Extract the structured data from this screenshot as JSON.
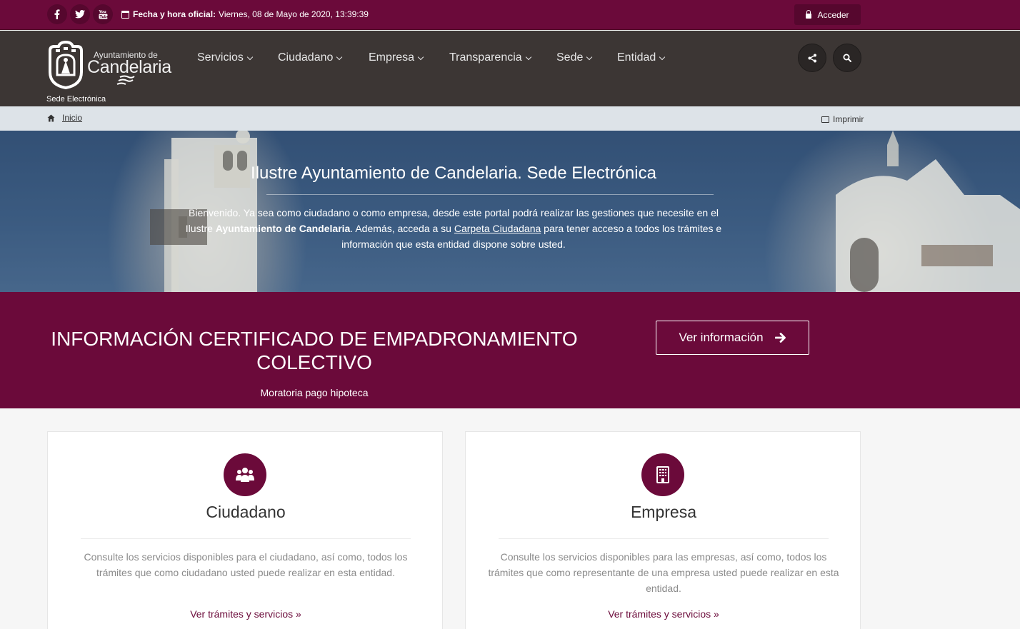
{
  "topbar": {
    "social": [
      {
        "name": "facebook-icon",
        "glyph": "f"
      },
      {
        "name": "twitter-icon",
        "glyph": "t"
      },
      {
        "name": "youtube-icon",
        "glyph": "You"
      }
    ],
    "fecha_label": "Fecha y hora oficial:",
    "fecha_value": "Viernes, 08 de Mayo de 2020, 13:39:39",
    "login_label": "Acceder"
  },
  "header": {
    "logo_small": "Ayuntamiento de",
    "logo_big": "Candelaria",
    "logo_sub": "Sede Electrónica",
    "nav": [
      "Servicios",
      "Ciudadano",
      "Empresa",
      "Transparencia",
      "Sede",
      "Entidad"
    ]
  },
  "breadcrumb": {
    "home_label": "Inicio",
    "print_label": "Imprimir"
  },
  "hero": {
    "title": "Ilustre Ayuntamiento de Candelaria. Sede Electrónica",
    "text_1": "Bienvenido. Ya sea como ciudadano o como empresa, desde este portal podrá realizar las gestiones que necesite en el Ilustre ",
    "text_bold": "Ayuntamiento de Candelaria",
    "text_2": ". Además, acceda a su ",
    "text_link": "Carpeta Ciudadana",
    "text_3": " para tener acceso a todos los trámites e información que esta entidad dispone sobre usted."
  },
  "promo": {
    "title": "INFORMACIÓN CERTIFICADO DE EMPADRONAMIENTO COLECTIVO",
    "subtitle": "Moratoria pago hipoteca",
    "button_label": "Ver información"
  },
  "cards": [
    {
      "title": "Ciudadano",
      "text": "Consulte los servicios disponibles para el ciudadano, así como, todos los trámites que como ciudadano usted puede realizar en esta entidad.",
      "link": "Ver trámites y servicios »"
    },
    {
      "title": "Empresa",
      "text": "Consulte los servicios disponibles para las empresas, así como, todos los trámites que como representante de una empresa usted puede realizar en esta entidad.",
      "link": "Ver trámites y servicios »"
    }
  ],
  "colors": {
    "brand": "#6b0a3a",
    "header": "#3c3634",
    "breadcrumb": "#dde3e8"
  }
}
